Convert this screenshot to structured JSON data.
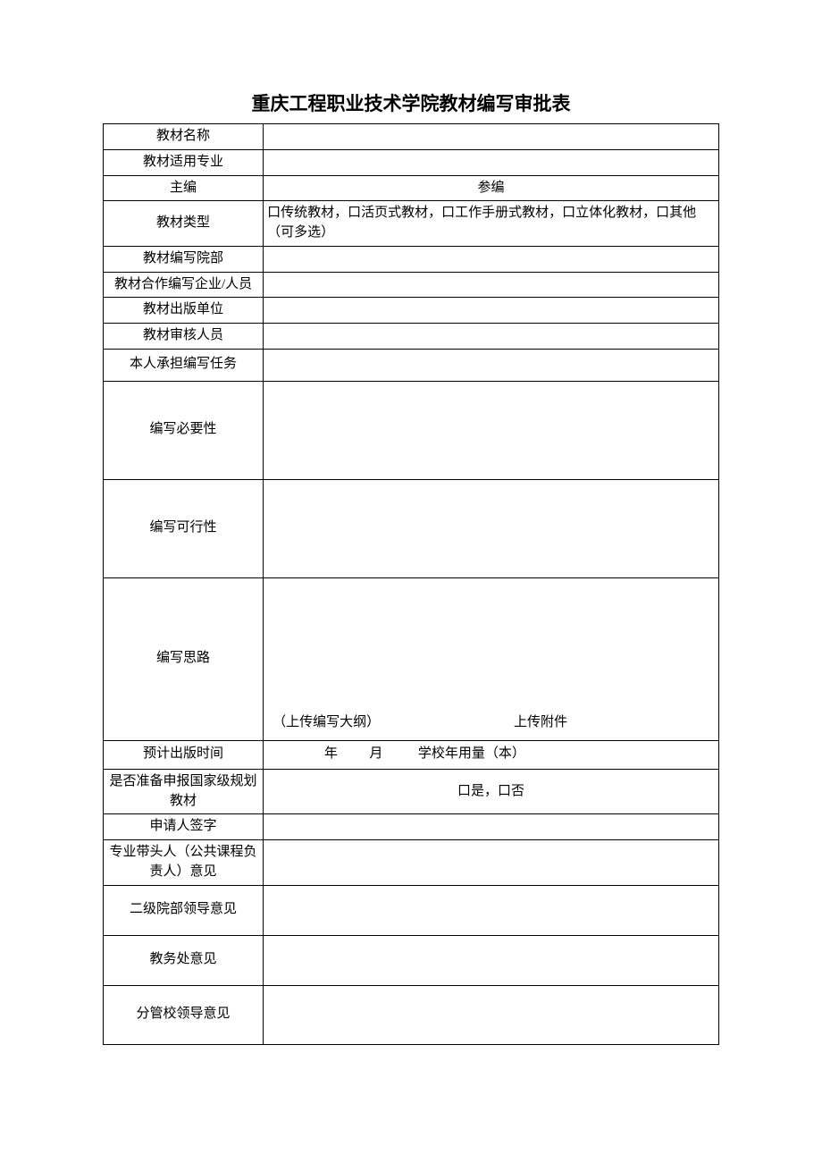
{
  "title": "重庆工程职业技术学院教材编写审批表",
  "rows": {
    "r1": "教材名称",
    "r2": "教材适用专业",
    "r3": "主编",
    "r3b": "参编",
    "r4": "教材类型",
    "r4val": "口传统教材，口活页式教材，口工作手册式教材，口立体化教材，口其他（可多选）",
    "r5": "教材编写院部",
    "r6": "教材合作编写企业/人员",
    "r7": "教材出版单位",
    "r8": "教材审核人员",
    "r9": "本人承担编写任务",
    "r10": "编写必要性",
    "r11": "编写可行性",
    "r12": "编写思路",
    "r12a": "（上传编写大纲）",
    "r12b": "上传附件",
    "r13": "预计出版时间",
    "r13y": "年",
    "r13m": "月",
    "r13q": "学校年用量（本）",
    "r14": "是否准备申报国家级规划教材",
    "r14v": "口是，口否",
    "r15": "申请人签字",
    "r16": "专业带头人（公共课程负责人）意见",
    "r17": "二级院部领导意见",
    "r18": "教务处意见",
    "r19": "分管校领导意见"
  }
}
